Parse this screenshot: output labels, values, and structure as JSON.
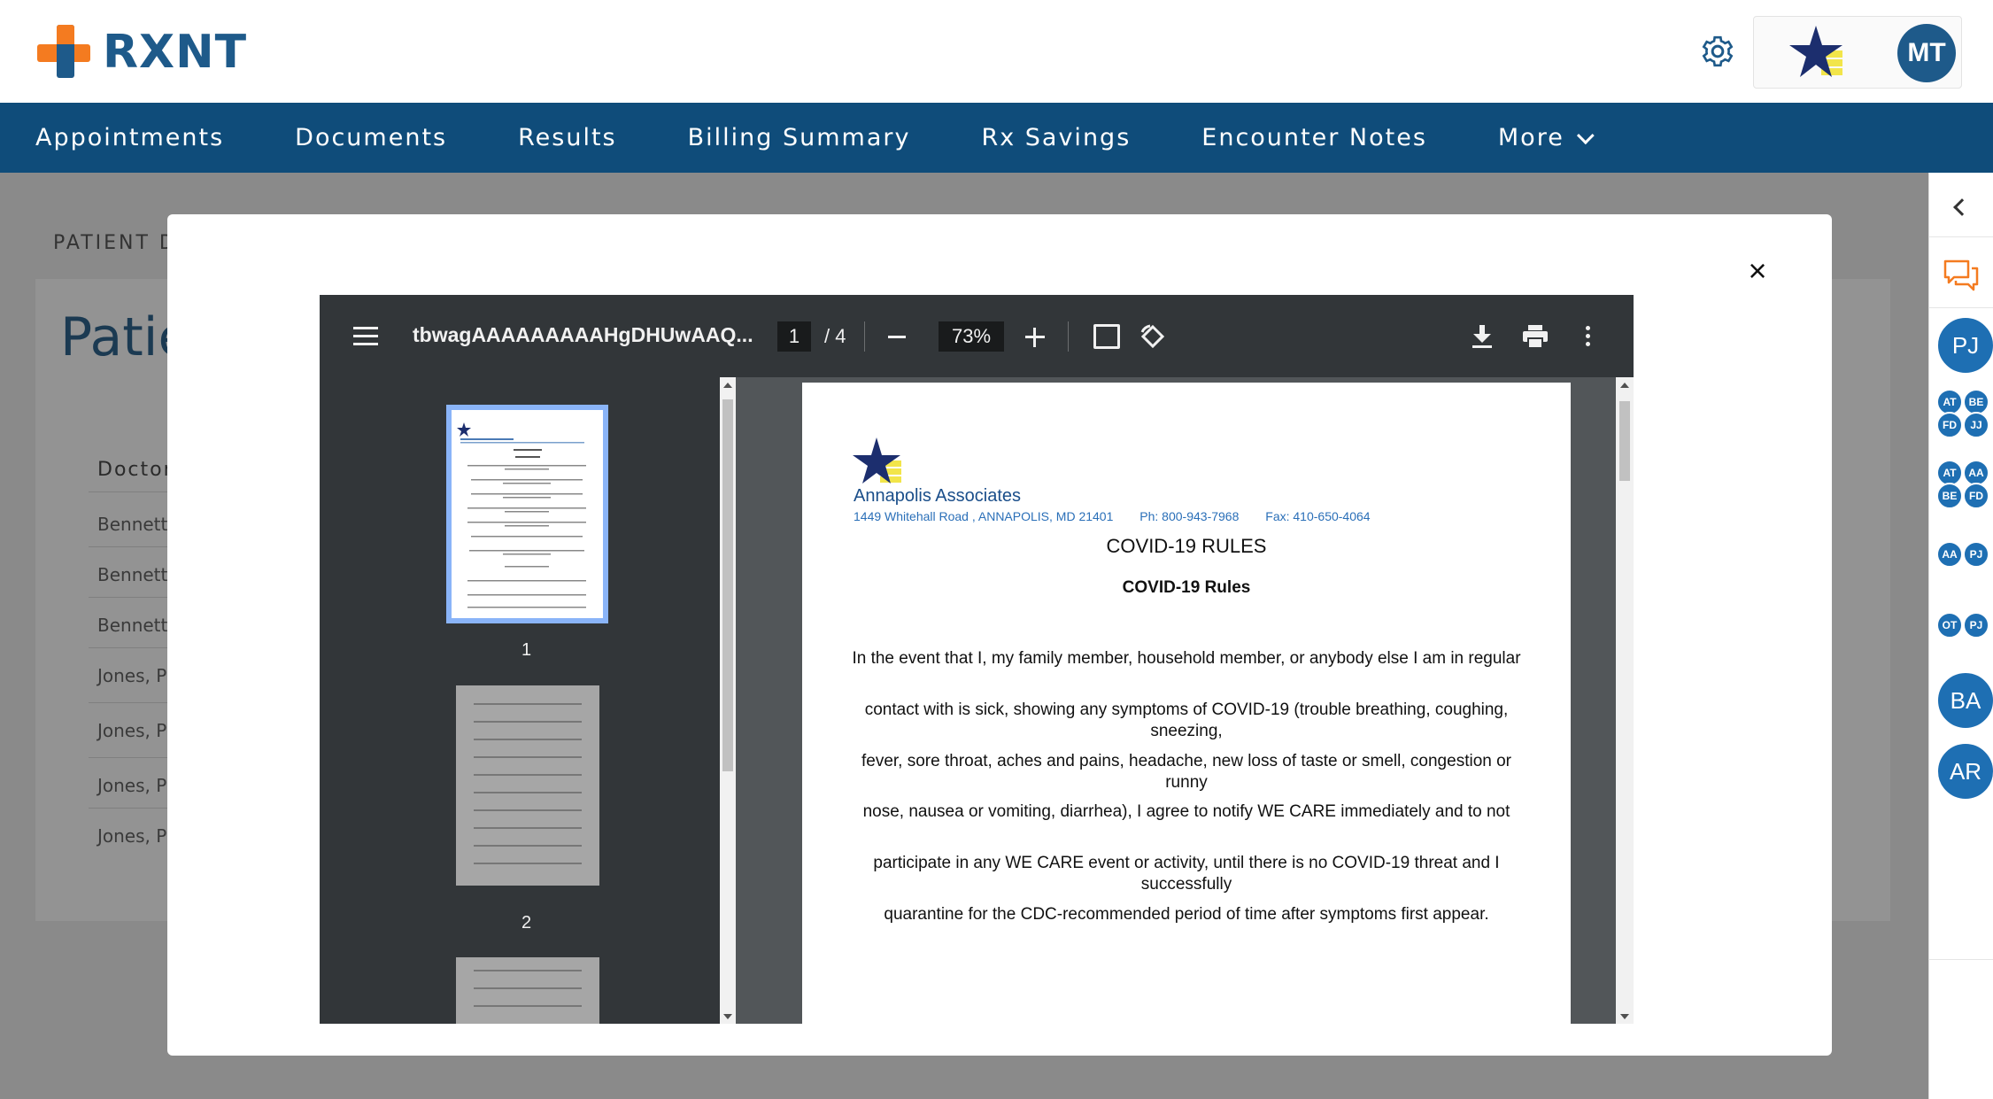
{
  "header": {
    "logo_text": "RXNT",
    "avatar_initials": "MT"
  },
  "nav": {
    "items": [
      "Appointments",
      "Documents",
      "Results",
      "Billing Summary",
      "Rx Savings",
      "Encounter Notes",
      "More"
    ]
  },
  "background": {
    "breadcrumb": "PATIENT D",
    "title": "Patie",
    "column_header": "Doctor",
    "rows": [
      "Bennett,",
      "Bennett,",
      "Bennett,",
      "Jones, P",
      "Jones, P",
      "Jones, P",
      "Jones, P"
    ]
  },
  "rail": {
    "avatars_big": [
      "PJ",
      "BA",
      "AR"
    ],
    "group1": [
      "AT",
      "BE",
      "FD",
      "JJ"
    ],
    "group2": [
      "AT",
      "AA",
      "BE",
      "FD"
    ],
    "group3": [
      "AA",
      "PJ"
    ],
    "group4": [
      "OT",
      "PJ"
    ]
  },
  "modal": {
    "close_label": "×"
  },
  "pdf": {
    "file_name": "tbwagAAAAAAAAAHgDHUwAAQ...",
    "current_page": "1",
    "page_total": "/ 4",
    "zoom": "73%",
    "thumbnails": [
      {
        "label": "1"
      },
      {
        "label": "2"
      }
    ],
    "document": {
      "org_name": "Annapolis Associates",
      "address": "1449 Whitehall Road , ANNAPOLIS, MD 21401",
      "phone": "Ph: 800-943-7968",
      "fax": "Fax: 410-650-4064",
      "heading": "COVID-19 RULES",
      "subheading": "COVID-19 Rules",
      "paragraphs": [
        "In the event that I, my family member, household member, or anybody else I am in regular",
        "contact with is sick, showing any symptoms of COVID-19 (trouble breathing, coughing, sneezing,",
        "fever, sore throat, aches and pains, headache, new loss of taste or smell, congestion or runny",
        "nose, nausea or vomiting, diarrhea), I agree to notify WE CARE immediately and to not",
        "participate in any WE CARE event or activity, until there is no COVID-19 threat and I successfully",
        "quarantine for the CDC-recommended period of time after symptoms first appear."
      ]
    }
  },
  "colors": {
    "brand_blue": "#1e5a8a",
    "brand_orange": "#f47b20",
    "nav_bg": "#0f4c7a",
    "avatar_blue": "#1e6fb3"
  }
}
